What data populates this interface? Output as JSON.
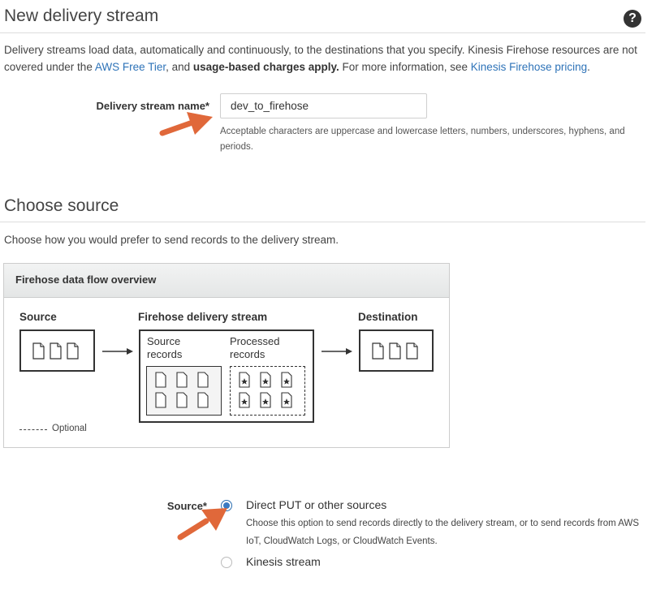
{
  "delivery": {
    "heading": "New delivery stream",
    "intro_a": "Delivery streams load data, automatically and continuously, to the destinations that you specify. Kinesis Firehose resources are not covered under the ",
    "intro_link_free_tier": "AWS Free Tier",
    "intro_b": ", and ",
    "intro_bold": "usage-based charges apply.",
    "intro_c": " For more information, see ",
    "intro_link_pricing": "Kinesis Firehose pricing",
    "intro_d": ".",
    "help_symbol": "?",
    "name_label": "Delivery stream name*",
    "name_value": "dev_to_firehose",
    "name_hint": "Acceptable characters are uppercase and lowercase letters, numbers, underscores, hyphens, and periods."
  },
  "source_section": {
    "heading": "Choose source",
    "description": "Choose how you would prefer to send records to the delivery stream."
  },
  "overview": {
    "header": "Firehose data flow overview",
    "source_title": "Source",
    "stream_title": "Firehose delivery stream",
    "destination_title": "Destination",
    "source_records": "Source records",
    "processed_records": "Processed records",
    "legend_optional": "Optional"
  },
  "source_field": {
    "label": "Source*",
    "options": [
      {
        "label": "Direct PUT or other sources",
        "description": "Choose this option to send records directly to the delivery stream, or to send records from AWS IoT, CloudWatch Logs, or CloudWatch Events.",
        "selected": true
      },
      {
        "label": "Kinesis stream",
        "selected": false
      }
    ]
  },
  "icons": [
    "help-icon",
    "document-icon",
    "starred-document-icon",
    "arrow-right-icon",
    "annotation-arrow"
  ],
  "colors": {
    "link": "#2e73b8",
    "annotation_arrow": "#e0683a",
    "radio_selected": "#3b7ac2"
  }
}
